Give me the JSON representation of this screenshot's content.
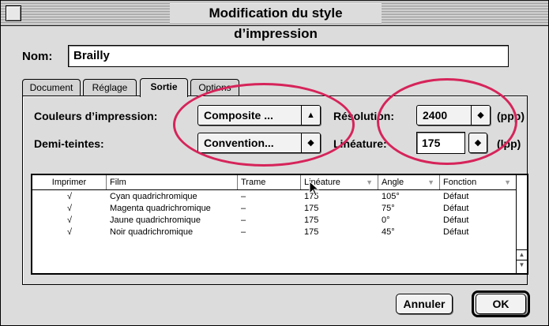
{
  "window": {
    "title": "Modification du style d’impression"
  },
  "name": {
    "label": "Nom:",
    "value": "Brailly"
  },
  "tabs": [
    {
      "label": "Document",
      "active": false
    },
    {
      "label": "Réglage",
      "active": false
    },
    {
      "label": "Sortie",
      "active": true
    },
    {
      "label": "Options",
      "active": false
    }
  ],
  "output": {
    "color_label": "Couleurs d’impression:",
    "color_value": "Composite ...",
    "halftone_label": "Demi-teintes:",
    "halftone_value": "Convention...",
    "resolution_label": "Résolution:",
    "resolution_value": "2400",
    "resolution_unit": "(ppp)",
    "frequency_label": "Linéature:",
    "frequency_value": "175",
    "frequency_unit": "(lpp)"
  },
  "table": {
    "headers": [
      "Imprimer",
      "Film",
      "Trame",
      "Linéature",
      "Angle",
      "Fonction"
    ],
    "rows": [
      {
        "print": "√",
        "film": "Cyan quadrichromique",
        "screen": "–",
        "frequency": "175",
        "angle": "105°",
        "function": "Défaut"
      },
      {
        "print": "√",
        "film": "Magenta quadrichromique",
        "screen": "–",
        "frequency": "175",
        "angle": "75°",
        "function": "Défaut"
      },
      {
        "print": "√",
        "film": "Jaune quadrichromique",
        "screen": "–",
        "frequency": "175",
        "angle": "0°",
        "function": "Défaut"
      },
      {
        "print": "√",
        "film": "Noir quadrichromique",
        "screen": "–",
        "frequency": "175",
        "angle": "45°",
        "function": "Défaut"
      }
    ]
  },
  "buttons": {
    "cancel": "Annuler",
    "ok": "OK"
  },
  "colors": {
    "highlight_ellipse": "#d6245a",
    "window_bg": "#dcdcdc"
  },
  "icons": {
    "popup_arrow": "up-down-arrows-icon",
    "cursor": "arrow-cursor-icon",
    "close": "close-box-icon"
  }
}
